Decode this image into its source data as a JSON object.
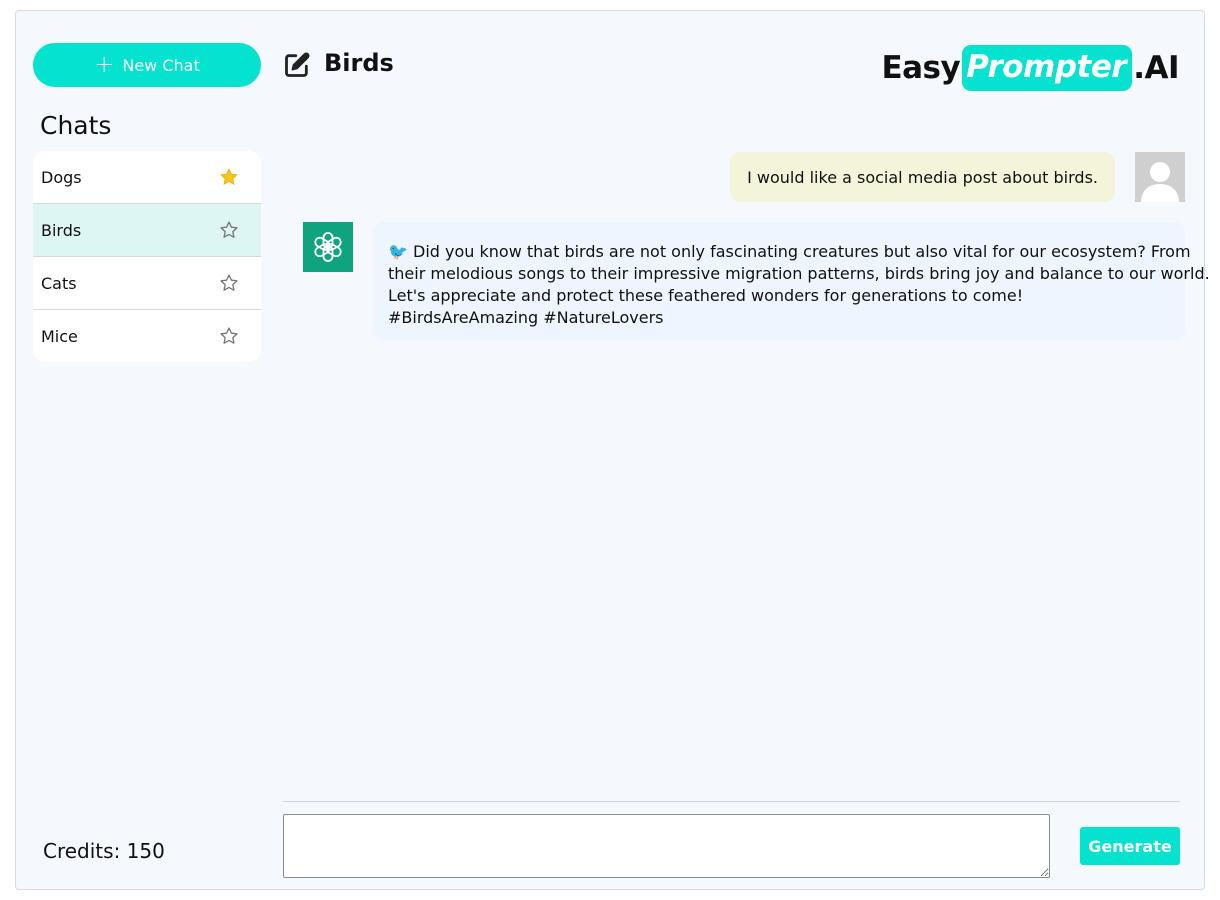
{
  "sidebar": {
    "new_chat_label": "New Chat",
    "chats_heading": "Chats",
    "items": [
      {
        "label": "Dogs",
        "starred": true
      },
      {
        "label": "Birds",
        "starred": false,
        "active": true
      },
      {
        "label": "Cats",
        "starred": false
      },
      {
        "label": "Mice",
        "starred": false
      }
    ],
    "credits": "Credits: 150"
  },
  "header": {
    "chat_title": "Birds",
    "logo": {
      "part1": "Easy",
      "part2": "Prompter",
      "part3": ".AI"
    }
  },
  "messages": {
    "user": {
      "text": "I would like a social media post about birds."
    },
    "assistant": {
      "lines": [
        "🐦 Did you know that birds are not only fascinating creatures but also vital for our ecosystem? From",
        "their melodious songs to their impressive migration patterns, birds bring joy and balance to our world.",
        "Let's appreciate and protect these feathered wonders for generations to come!",
        "#BirdsAreAmazing  #NatureLovers"
      ]
    }
  },
  "composer": {
    "input_value": "",
    "generate_label": "Generate"
  },
  "colors": {
    "accent": "#05e2cf",
    "star_active": "#f5c518",
    "assistant_avatar": "#10a37f",
    "user_bubble": "#f4f4da",
    "assistant_bubble": "#eef5fe"
  },
  "icons": {
    "new_chat": "plus-icon",
    "title": "edit-icon",
    "star_filled": "star-filled-icon",
    "star_outline": "star-outline-icon",
    "user_avatar": "user-avatar-icon",
    "assistant_avatar": "openai-logo-icon"
  }
}
